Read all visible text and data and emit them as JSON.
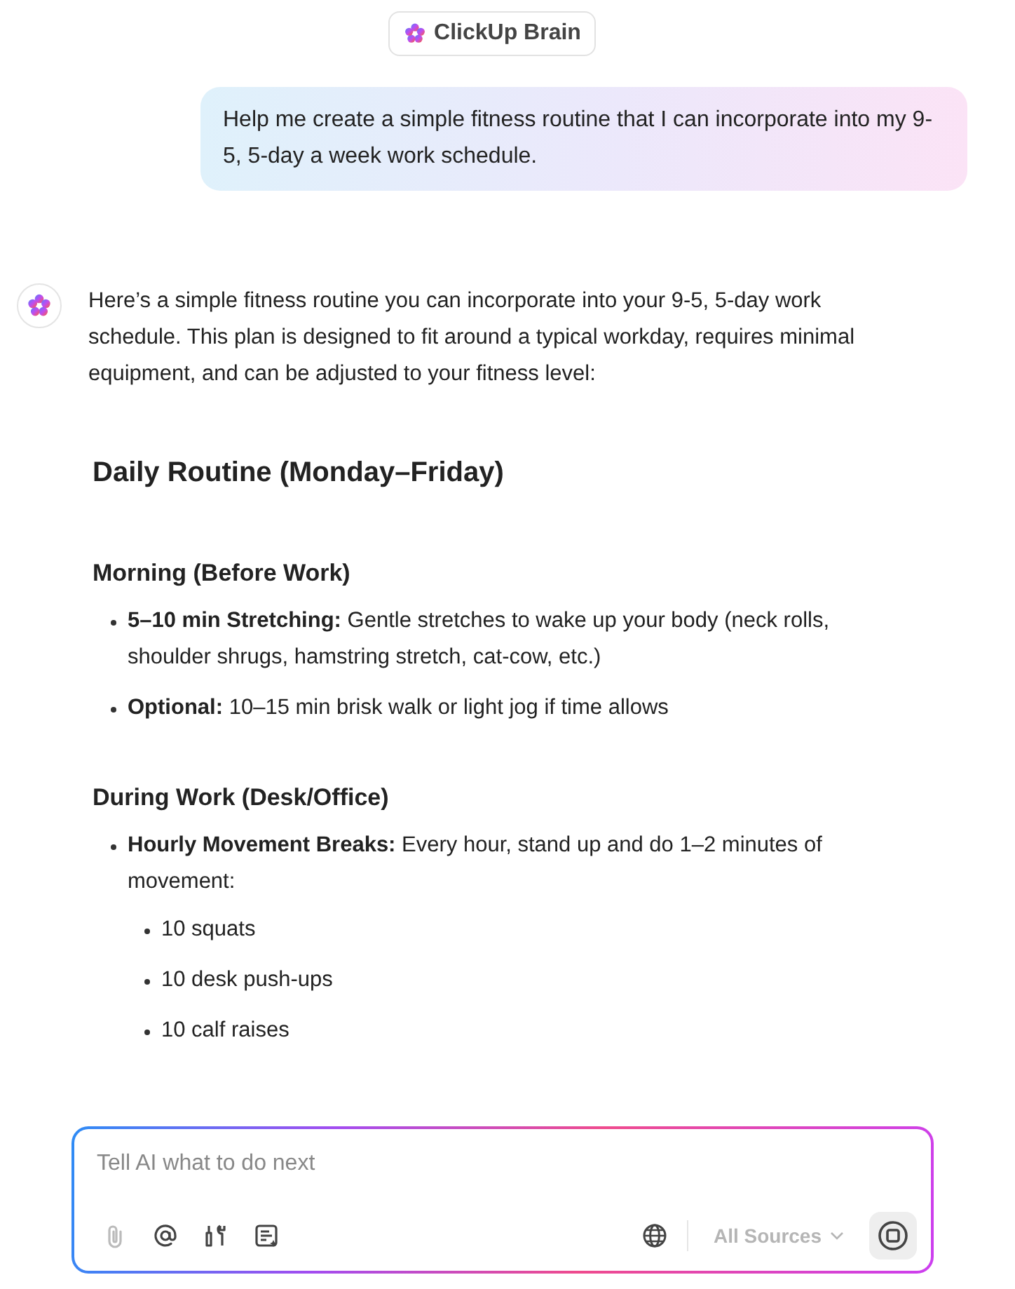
{
  "header": {
    "title": "ClickUp Brain"
  },
  "user_message": "Help me create a simple fitness routine that I can incorporate into my 9-5, 5-day a week work schedule.",
  "reply": {
    "intro": "Here’s a simple fitness routine you can incorporate into your 9-5, 5-day work schedule. This plan is designed to fit around a typical workday, requires minimal equipment, and can be adjusted to your fitness level:",
    "heading": "Daily Routine (Monday–Friday)",
    "sections": [
      {
        "title": "Morning (Before Work)",
        "items": [
          {
            "text": "**5–10 min Stretching:** Gentle stretches to wake up your body (neck rolls, shoulder shrugs, hamstring stretch, cat-cow, etc.)"
          },
          {
            "text": "**Optional:** 10–15 min brisk walk or light jog if time allows"
          }
        ]
      },
      {
        "title": "During Work (Desk/Office)",
        "items": [
          {
            "text": "**Hourly Movement Breaks:** Every hour, stand up and do 1–2 minutes of movement:",
            "children": [
              {
                "text": "10 squats"
              },
              {
                "text": "10 desk push-ups"
              },
              {
                "text": "10 calf raises"
              }
            ]
          }
        ]
      }
    ]
  },
  "composer": {
    "placeholder": "Tell AI what to do next",
    "tools": [
      {
        "kind": "attach",
        "disabled": true
      },
      {
        "kind": "mention",
        "disabled": false
      },
      {
        "kind": "tools",
        "disabled": false
      },
      {
        "kind": "notes",
        "disabled": false
      }
    ],
    "sources": {
      "label": "All Sources",
      "disabled": true
    }
  }
}
